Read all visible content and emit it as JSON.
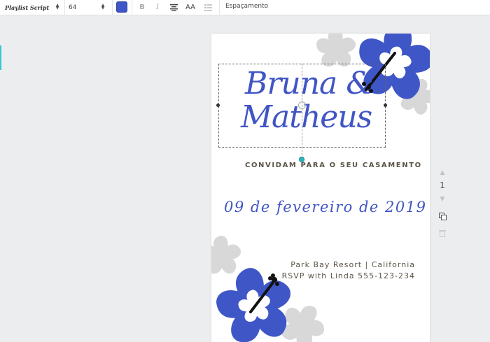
{
  "toolbar": {
    "font_name": "Playlist Script",
    "font_size": "64",
    "text_color": "#3f56c7",
    "bold_icon": "bold-icon",
    "italic_icon": "italic-icon",
    "align_icon": "align-center-icon",
    "case_label": "AA",
    "list_icon": "list-icon",
    "spacing_label": "Espaçamento"
  },
  "invitation": {
    "name_line1": "Bruna &",
    "name_line2": "Matheus",
    "subtitle": "CONVIDAM PARA O SEU CASAMENTO",
    "date": "09 de fevereiro de 2019",
    "venue": "Park Bay Resort | California",
    "rsvp": "RSVP with Linda 555-123-234"
  },
  "page_controls": {
    "page_number": "1"
  },
  "colors": {
    "accent_blue": "#4155c5",
    "brown_text": "#5a5346",
    "flower_grey": "#d6d6d6",
    "selection_teal": "#2ab7c4"
  }
}
